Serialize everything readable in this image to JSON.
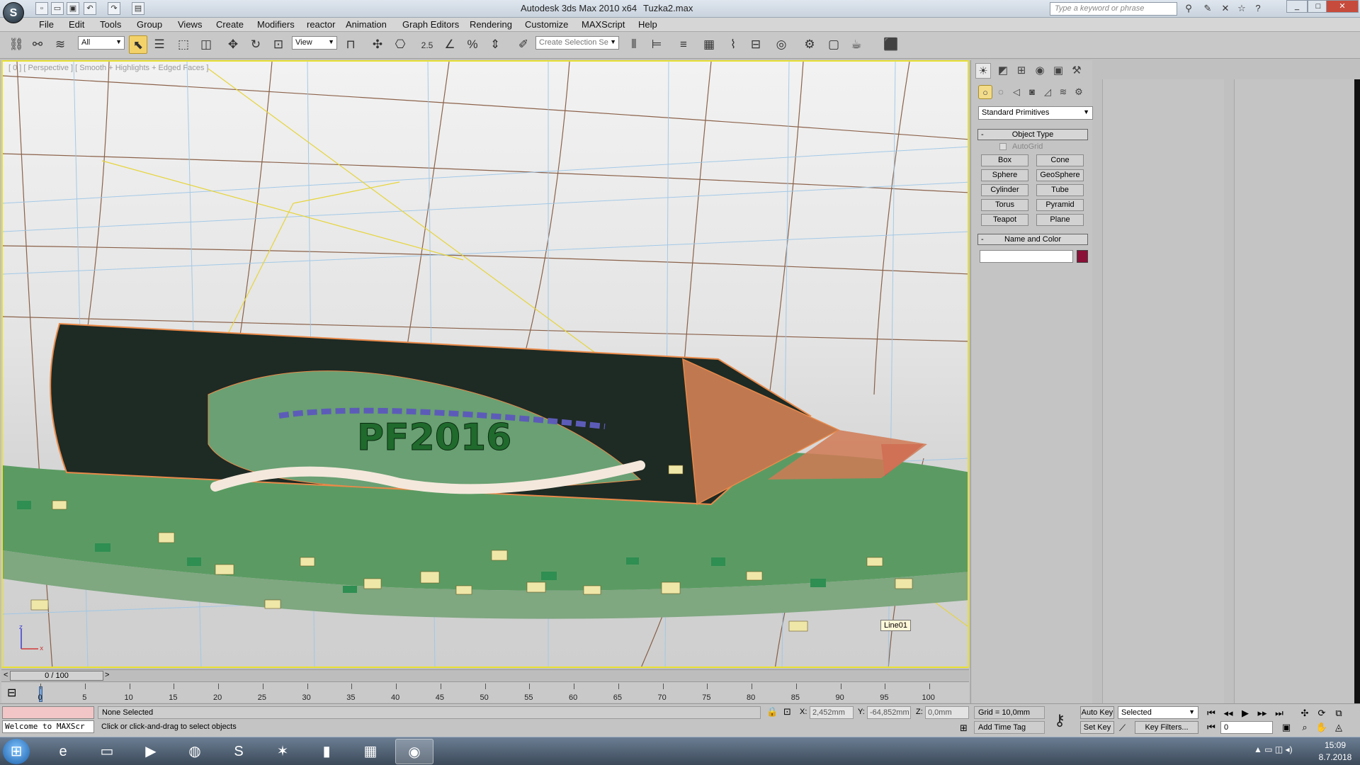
{
  "titlebar": {
    "title": "Autodesk 3ds Max  2010 x64",
    "file": "Tuzka2.max",
    "search_placeholder": "Type a keyword or phrase"
  },
  "menu": [
    "File",
    "Edit",
    "Tools",
    "Group",
    "Views",
    "Create",
    "Modifiers",
    "reactor",
    "Animation",
    "Graph Editors",
    "Rendering",
    "Customize",
    "MAXScript",
    "Help"
  ],
  "toolbar": {
    "selection_filter": "All",
    "reference_coord": "View",
    "snap_value": "2.5",
    "selection_set_placeholder": "Create Selection Se"
  },
  "viewport": {
    "label": "[ 0 ] [ Perspective ] [ Smooth + Highlights + Edged Faces ]",
    "object_tag": "Line01",
    "embossed_text": "PF2016",
    "axis_z": "z",
    "axis_x": "x"
  },
  "command_panel": {
    "primitive_category": "Standard Primitives",
    "object_type_title": "Object Type",
    "autogrid_label": "AutoGrid",
    "object_buttons": [
      "Box",
      "Cone",
      "Sphere",
      "GeoSphere",
      "Cylinder",
      "Tube",
      "Torus",
      "Pyramid",
      "Teapot",
      "Plane"
    ],
    "name_and_color_title": "Name and Color",
    "object_color": "#8a1038"
  },
  "time_slider": {
    "frame_display": "0 / 100",
    "prev": "<",
    "next": ">"
  },
  "trackbar": {
    "ticks": [
      "0",
      "5",
      "10",
      "15",
      "20",
      "25",
      "30",
      "35",
      "40",
      "45",
      "50",
      "55",
      "60",
      "65",
      "70",
      "75",
      "80",
      "85",
      "90",
      "95",
      "100"
    ]
  },
  "status": {
    "maxscript_text": "Welcome to MAXScr",
    "selection_text": "None Selected",
    "prompt_text": "Click or click-and-drag to select objects",
    "x_label": "X:",
    "x_value": "2,452mm",
    "y_label": "Y:",
    "y_value": "-64,852mm",
    "z_label": "Z:",
    "z_value": "0,0mm",
    "grid_text": "Grid = 10,0mm",
    "add_time_tag": "Add Time Tag",
    "auto_key": "Auto Key",
    "set_key": "Set Key",
    "key_mode": "Selected",
    "key_filters": "Key Filters...",
    "current_frame": "0"
  },
  "taskbar": {
    "clock_time": "15:09",
    "clock_date": "8.7.2018"
  }
}
